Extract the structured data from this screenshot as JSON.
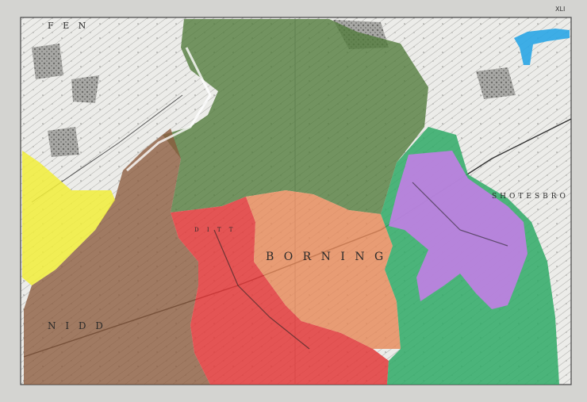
{
  "map": {
    "labels": {
      "west": "F E N",
      "northwest_parish": "D I T T",
      "centre_town": "B O R N I N G",
      "east_town": "SHOTESBRO",
      "south": "N I D D",
      "sheet_id": "XLI"
    },
    "regions": [
      {
        "name": "green-region",
        "color": "#4f7a3a"
      },
      {
        "name": "brown-region",
        "color": "#8a5a3c"
      },
      {
        "name": "yellow-region",
        "color": "#f2ef3a"
      },
      {
        "name": "red-region",
        "color": "#e33a3a"
      },
      {
        "name": "orange-region",
        "color": "#e68a5a"
      },
      {
        "name": "purple-region",
        "color": "#c27ee6"
      },
      {
        "name": "teal-region",
        "color": "#2faa66"
      },
      {
        "name": "blue-region",
        "color": "#2aa6e6"
      }
    ]
  }
}
